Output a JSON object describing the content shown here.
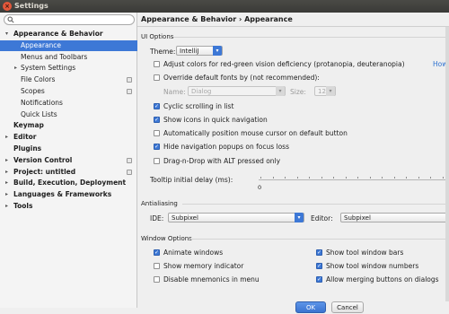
{
  "window": {
    "title": "Settings"
  },
  "search": {
    "placeholder": "",
    "value": ""
  },
  "sidebar": {
    "items": [
      {
        "label": "Appearance & Behavior",
        "level": 0,
        "expanded": true,
        "bold": true
      },
      {
        "label": "Appearance",
        "level": 1,
        "selected": true
      },
      {
        "label": "Menus and Toolbars",
        "level": 1
      },
      {
        "label": "System Settings",
        "level": 1,
        "collapsed": true
      },
      {
        "label": "File Colors",
        "level": 1,
        "project": true
      },
      {
        "label": "Scopes",
        "level": 1,
        "project": true
      },
      {
        "label": "Notifications",
        "level": 1
      },
      {
        "label": "Quick Lists",
        "level": 1
      },
      {
        "label": "Keymap",
        "level": 0,
        "bold": true
      },
      {
        "label": "Editor",
        "level": 0,
        "bold": true,
        "collapsed": true
      },
      {
        "label": "Plugins",
        "level": 0,
        "bold": true
      },
      {
        "label": "Version Control",
        "level": 0,
        "bold": true,
        "collapsed": true,
        "project": true
      },
      {
        "label": "Project: untitled",
        "level": 0,
        "bold": true,
        "collapsed": true,
        "project": true
      },
      {
        "label": "Build, Execution, Deployment",
        "level": 0,
        "bold": true,
        "collapsed": true
      },
      {
        "label": "Languages & Frameworks",
        "level": 0,
        "bold": true,
        "collapsed": true
      },
      {
        "label": "Tools",
        "level": 0,
        "bold": true,
        "collapsed": true
      }
    ]
  },
  "main": {
    "breadcrumb": "Appearance & Behavior › Appearance",
    "ui_options": {
      "section": "UI Options",
      "theme_label": "Theme:",
      "theme_value": "IntelliJ",
      "adjust_colors": {
        "label": "Adjust colors for red-green vision deficiency (protanopia, deuteranopia)",
        "checked": false,
        "link": "How"
      },
      "override_fonts": {
        "label": "Override default fonts by (not recommended):",
        "checked": false
      },
      "name_label": "Name:",
      "name_value": "Dialog",
      "size_label": "Size:",
      "size_value": "12",
      "cyclic_scrolling": {
        "label": "Cyclic scrolling in list",
        "checked": true
      },
      "show_icons": {
        "label": "Show icons in quick navigation",
        "checked": true
      },
      "auto_position": {
        "label": "Automatically position mouse cursor on default button",
        "checked": false
      },
      "hide_popups": {
        "label": "Hide navigation popups on focus loss",
        "checked": true
      },
      "drag_drop": {
        "label": "Drag-n-Drop with ALT pressed only",
        "checked": false
      },
      "tooltip_label": "Tooltip initial delay (ms):",
      "tooltip_min": "0"
    },
    "antialiasing": {
      "section": "Antialiasing",
      "ide_label": "IDE:",
      "ide_value": "Subpixel",
      "editor_label": "Editor:",
      "editor_value": "Subpixel"
    },
    "window_options": {
      "section": "Window Options",
      "animate_windows": {
        "label": "Animate windows",
        "checked": true
      },
      "show_memory": {
        "label": "Show memory indicator",
        "checked": false
      },
      "disable_mnemonics": {
        "label": "Disable mnemonics in menu",
        "checked": false
      },
      "show_tool_bars": {
        "label": "Show tool window bars",
        "checked": true
      },
      "show_tool_numbers": {
        "label": "Show tool window numbers",
        "checked": true
      },
      "allow_dialogs": {
        "label": "Allow merging buttons on dialogs",
        "checked": true
      }
    }
  },
  "buttons": {
    "ok": "OK",
    "cancel": "Cancel"
  },
  "colors": {
    "accent": "#3d78d6",
    "titlebar": "#3c3b37",
    "close": "#e4573a"
  }
}
